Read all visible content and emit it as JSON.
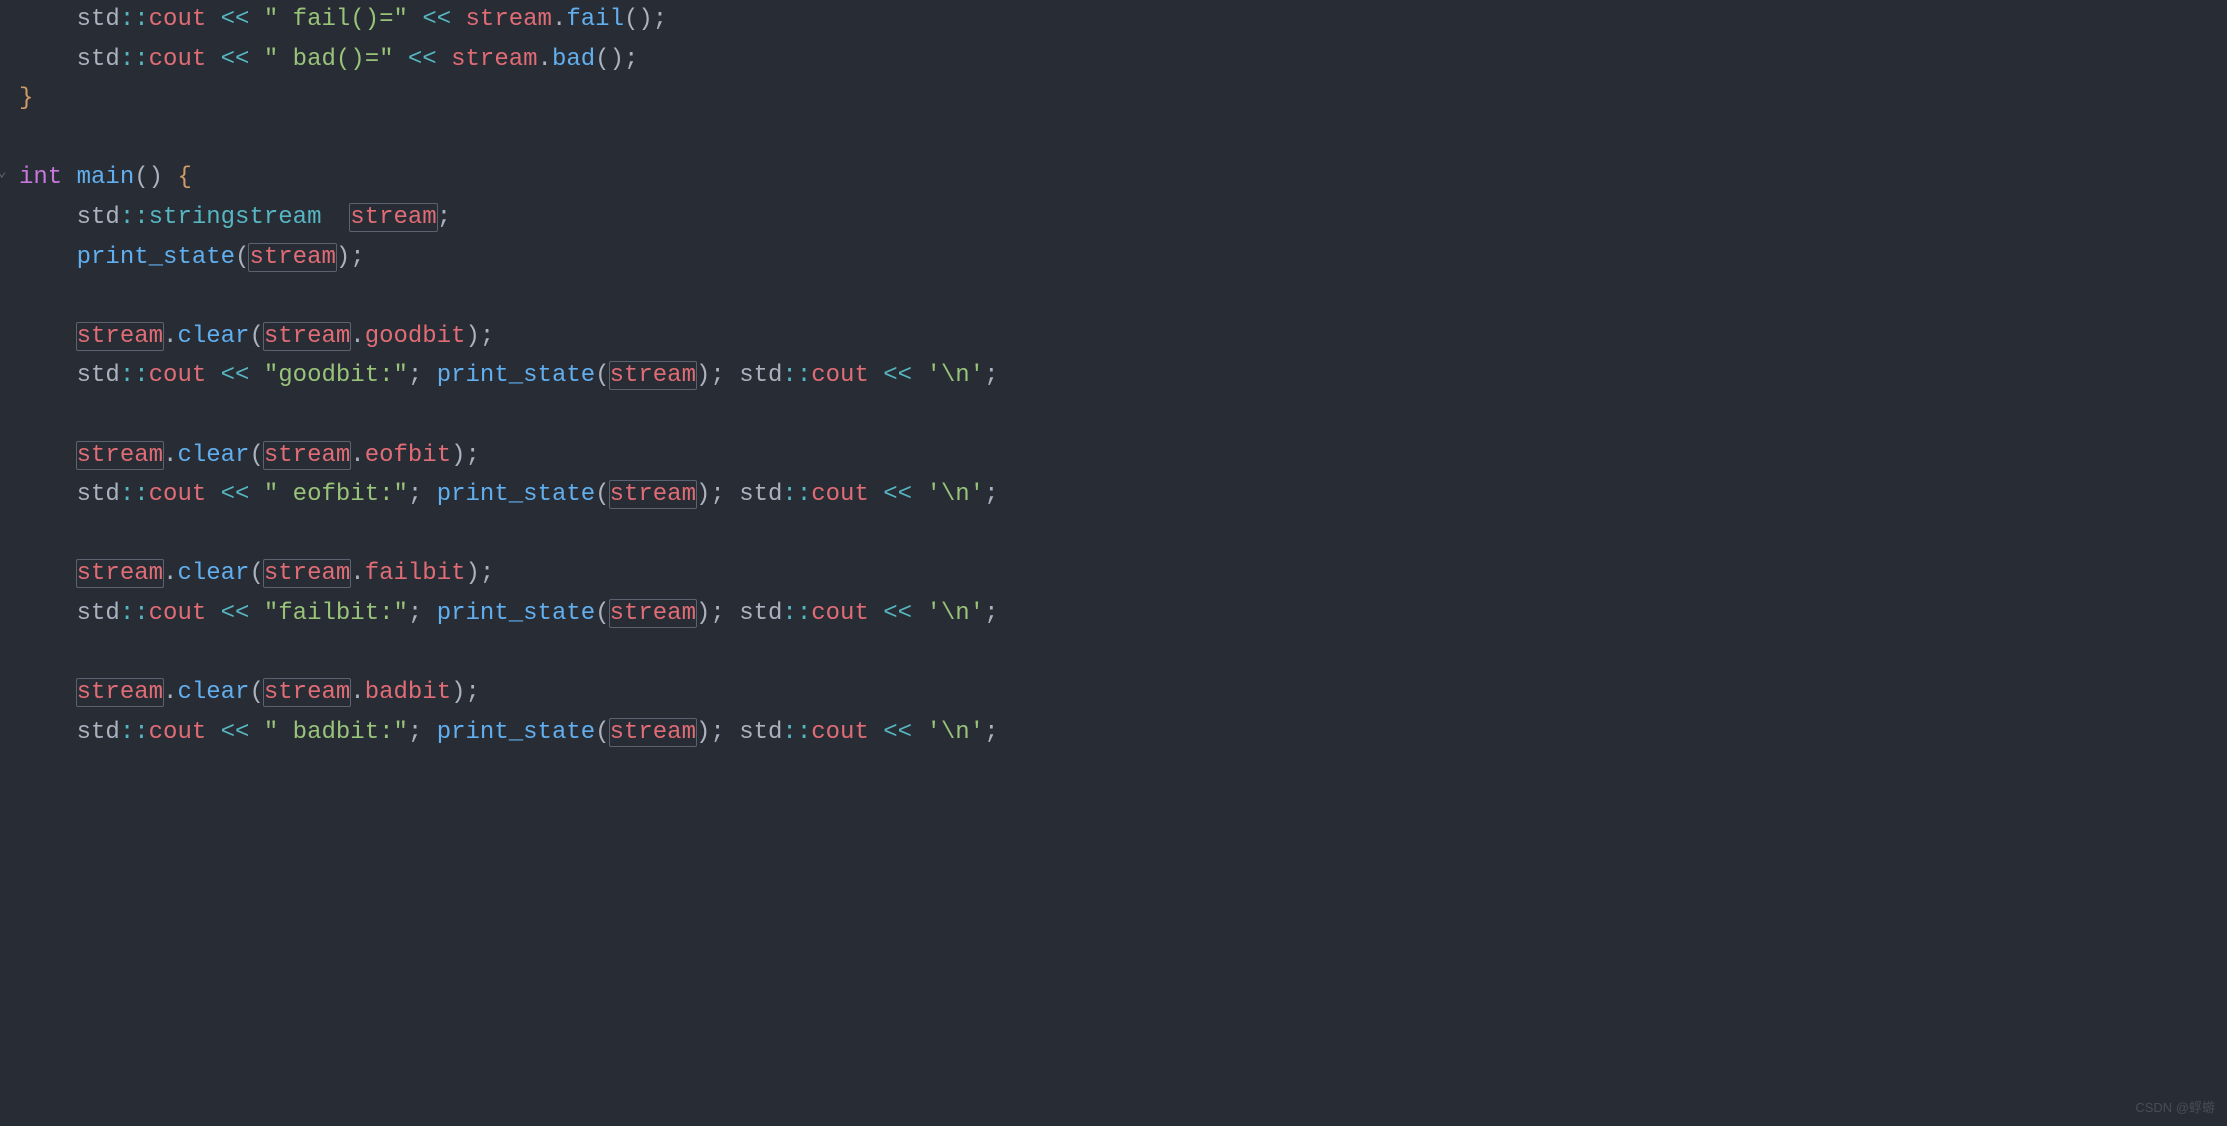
{
  "editor": {
    "language": "cpp",
    "theme": "one-dark",
    "highlighted_symbol": "stream",
    "fold_markers": [
      {
        "line_index": 4,
        "glyph": "⌄"
      }
    ],
    "indent_guides": true,
    "watermark": "CSDN @蜉蝣"
  },
  "code": {
    "lines": [
      {
        "indent": 1,
        "segs": [
          {
            "t": "ns",
            "v": "std"
          },
          {
            "t": "op",
            "v": "::"
          },
          {
            "t": "var",
            "v": "cout"
          },
          {
            "t": "ns",
            "v": " "
          },
          {
            "t": "op",
            "v": "<<"
          },
          {
            "t": "ns",
            "v": " "
          },
          {
            "t": "str",
            "v": "\" fail()=\""
          },
          {
            "t": "ns",
            "v": " "
          },
          {
            "t": "op",
            "v": "<<"
          },
          {
            "t": "ns",
            "v": " "
          },
          {
            "t": "var",
            "v": "stream"
          },
          {
            "t": "punct",
            "v": "."
          },
          {
            "t": "func",
            "v": "fail"
          },
          {
            "t": "punct",
            "v": "();"
          }
        ]
      },
      {
        "indent": 1,
        "segs": [
          {
            "t": "ns",
            "v": "std"
          },
          {
            "t": "op",
            "v": "::"
          },
          {
            "t": "var",
            "v": "cout"
          },
          {
            "t": "ns",
            "v": " "
          },
          {
            "t": "op",
            "v": "<<"
          },
          {
            "t": "ns",
            "v": " "
          },
          {
            "t": "str",
            "v": "\" bad()=\""
          },
          {
            "t": "ns",
            "v": " "
          },
          {
            "t": "op",
            "v": "<<"
          },
          {
            "t": "ns",
            "v": " "
          },
          {
            "t": "var",
            "v": "stream"
          },
          {
            "t": "punct",
            "v": "."
          },
          {
            "t": "func",
            "v": "bad"
          },
          {
            "t": "punct",
            "v": "();"
          }
        ]
      },
      {
        "indent": 0,
        "segs": [
          {
            "t": "brace",
            "v": "}"
          }
        ]
      },
      {
        "indent": 0,
        "segs": []
      },
      {
        "indent": 0,
        "segs": [
          {
            "t": "kw",
            "v": "int"
          },
          {
            "t": "ns",
            "v": " "
          },
          {
            "t": "func",
            "v": "main"
          },
          {
            "t": "punct",
            "v": "() "
          },
          {
            "t": "brace",
            "v": "{"
          }
        ]
      },
      {
        "indent": 1,
        "segs": [
          {
            "t": "ns",
            "v": "std"
          },
          {
            "t": "op",
            "v": "::"
          },
          {
            "t": "type",
            "v": "stringstream"
          },
          {
            "t": "ns",
            "v": "  "
          },
          {
            "t": "var",
            "v": "stream",
            "hl": true
          },
          {
            "t": "punct",
            "v": ";"
          }
        ]
      },
      {
        "indent": 1,
        "segs": [
          {
            "t": "func",
            "v": "print_state"
          },
          {
            "t": "punct",
            "v": "("
          },
          {
            "t": "var",
            "v": "stream",
            "hl": true
          },
          {
            "t": "punct",
            "v": ");"
          }
        ]
      },
      {
        "indent": 0,
        "segs": []
      },
      {
        "indent": 1,
        "segs": [
          {
            "t": "var",
            "v": "stream",
            "hl": true
          },
          {
            "t": "punct",
            "v": "."
          },
          {
            "t": "func",
            "v": "clear"
          },
          {
            "t": "punct",
            "v": "("
          },
          {
            "t": "var",
            "v": "stream",
            "hl": true
          },
          {
            "t": "punct",
            "v": "."
          },
          {
            "t": "member",
            "v": "goodbit"
          },
          {
            "t": "punct",
            "v": ");"
          }
        ]
      },
      {
        "indent": 1,
        "segs": [
          {
            "t": "ns",
            "v": "std"
          },
          {
            "t": "op",
            "v": "::"
          },
          {
            "t": "var",
            "v": "cout"
          },
          {
            "t": "ns",
            "v": " "
          },
          {
            "t": "op",
            "v": "<<"
          },
          {
            "t": "ns",
            "v": " "
          },
          {
            "t": "str",
            "v": "\"goodbit:\""
          },
          {
            "t": "punct",
            "v": "; "
          },
          {
            "t": "func",
            "v": "print_state"
          },
          {
            "t": "punct",
            "v": "("
          },
          {
            "t": "var",
            "v": "stream",
            "hl": true
          },
          {
            "t": "punct",
            "v": "); "
          },
          {
            "t": "ns",
            "v": "std"
          },
          {
            "t": "op",
            "v": "::"
          },
          {
            "t": "var",
            "v": "cout"
          },
          {
            "t": "ns",
            "v": " "
          },
          {
            "t": "op",
            "v": "<<"
          },
          {
            "t": "ns",
            "v": " "
          },
          {
            "t": "str",
            "v": "'\\n'"
          },
          {
            "t": "punct",
            "v": ";"
          }
        ]
      },
      {
        "indent": 0,
        "segs": []
      },
      {
        "indent": 1,
        "segs": [
          {
            "t": "var",
            "v": "stream",
            "hl": true
          },
          {
            "t": "punct",
            "v": "."
          },
          {
            "t": "func",
            "v": "clear"
          },
          {
            "t": "punct",
            "v": "("
          },
          {
            "t": "var",
            "v": "stream",
            "hl": true
          },
          {
            "t": "punct",
            "v": "."
          },
          {
            "t": "member",
            "v": "eofbit"
          },
          {
            "t": "punct",
            "v": ");"
          }
        ]
      },
      {
        "indent": 1,
        "segs": [
          {
            "t": "ns",
            "v": "std"
          },
          {
            "t": "op",
            "v": "::"
          },
          {
            "t": "var",
            "v": "cout"
          },
          {
            "t": "ns",
            "v": " "
          },
          {
            "t": "op",
            "v": "<<"
          },
          {
            "t": "ns",
            "v": " "
          },
          {
            "t": "str",
            "v": "\" eofbit:\""
          },
          {
            "t": "punct",
            "v": "; "
          },
          {
            "t": "func",
            "v": "print_state"
          },
          {
            "t": "punct",
            "v": "("
          },
          {
            "t": "var",
            "v": "stream",
            "hl": true
          },
          {
            "t": "punct",
            "v": "); "
          },
          {
            "t": "ns",
            "v": "std"
          },
          {
            "t": "op",
            "v": "::"
          },
          {
            "t": "var",
            "v": "cout"
          },
          {
            "t": "ns",
            "v": " "
          },
          {
            "t": "op",
            "v": "<<"
          },
          {
            "t": "ns",
            "v": " "
          },
          {
            "t": "str",
            "v": "'\\n'"
          },
          {
            "t": "punct",
            "v": ";"
          }
        ]
      },
      {
        "indent": 0,
        "segs": []
      },
      {
        "indent": 1,
        "segs": [
          {
            "t": "var",
            "v": "stream",
            "hl": true
          },
          {
            "t": "punct",
            "v": "."
          },
          {
            "t": "func",
            "v": "clear"
          },
          {
            "t": "punct",
            "v": "("
          },
          {
            "t": "var",
            "v": "stream",
            "hl": true
          },
          {
            "t": "punct",
            "v": "."
          },
          {
            "t": "member",
            "v": "failbit"
          },
          {
            "t": "punct",
            "v": ");"
          }
        ]
      },
      {
        "indent": 1,
        "segs": [
          {
            "t": "ns",
            "v": "std"
          },
          {
            "t": "op",
            "v": "::"
          },
          {
            "t": "var",
            "v": "cout"
          },
          {
            "t": "ns",
            "v": " "
          },
          {
            "t": "op",
            "v": "<<"
          },
          {
            "t": "ns",
            "v": " "
          },
          {
            "t": "str",
            "v": "\"failbit:\""
          },
          {
            "t": "punct",
            "v": "; "
          },
          {
            "t": "func",
            "v": "print_state"
          },
          {
            "t": "punct",
            "v": "("
          },
          {
            "t": "var",
            "v": "stream",
            "hl": true
          },
          {
            "t": "punct",
            "v": "); "
          },
          {
            "t": "ns",
            "v": "std"
          },
          {
            "t": "op",
            "v": "::"
          },
          {
            "t": "var",
            "v": "cout"
          },
          {
            "t": "ns",
            "v": " "
          },
          {
            "t": "op",
            "v": "<<"
          },
          {
            "t": "ns",
            "v": " "
          },
          {
            "t": "str",
            "v": "'\\n'"
          },
          {
            "t": "punct",
            "v": ";"
          }
        ]
      },
      {
        "indent": 0,
        "segs": []
      },
      {
        "indent": 1,
        "segs": [
          {
            "t": "var",
            "v": "stream",
            "hl": true
          },
          {
            "t": "punct",
            "v": "."
          },
          {
            "t": "func",
            "v": "clear"
          },
          {
            "t": "punct",
            "v": "("
          },
          {
            "t": "var",
            "v": "stream",
            "hl": true
          },
          {
            "t": "punct",
            "v": "."
          },
          {
            "t": "member",
            "v": "badbit"
          },
          {
            "t": "punct",
            "v": ");"
          }
        ]
      },
      {
        "indent": 1,
        "segs": [
          {
            "t": "ns",
            "v": "std"
          },
          {
            "t": "op",
            "v": "::"
          },
          {
            "t": "var",
            "v": "cout"
          },
          {
            "t": "ns",
            "v": " "
          },
          {
            "t": "op",
            "v": "<<"
          },
          {
            "t": "ns",
            "v": " "
          },
          {
            "t": "str",
            "v": "\" badbit:\""
          },
          {
            "t": "punct",
            "v": "; "
          },
          {
            "t": "func",
            "v": "print_state"
          },
          {
            "t": "punct",
            "v": "("
          },
          {
            "t": "var",
            "v": "stream",
            "hl": true
          },
          {
            "t": "punct",
            "v": "); "
          },
          {
            "t": "ns",
            "v": "std"
          },
          {
            "t": "op",
            "v": "::"
          },
          {
            "t": "var",
            "v": "cout"
          },
          {
            "t": "ns",
            "v": " "
          },
          {
            "t": "op",
            "v": "<<"
          },
          {
            "t": "ns",
            "v": " "
          },
          {
            "t": "str",
            "v": "'\\n'"
          },
          {
            "t": "punct",
            "v": ";"
          }
        ]
      }
    ]
  }
}
